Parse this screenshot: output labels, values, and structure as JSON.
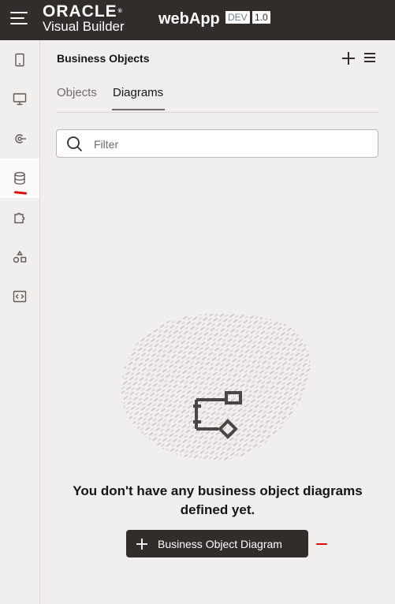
{
  "header": {
    "brand_top": "ORACLE",
    "brand_bottom": "Visual Builder",
    "app_name": "webApp",
    "badge_env": "DEV",
    "badge_version": "1.0"
  },
  "rail": {
    "items": [
      {
        "icon": "mobile-icon"
      },
      {
        "icon": "desktop-icon"
      },
      {
        "icon": "service-connection-icon"
      },
      {
        "icon": "database-icon",
        "active": true
      },
      {
        "icon": "puzzle-icon"
      },
      {
        "icon": "shapes-icon"
      },
      {
        "icon": "code-icon"
      }
    ]
  },
  "panel": {
    "title": "Business Objects",
    "tabs": [
      {
        "label": "Objects",
        "selected": false
      },
      {
        "label": "Diagrams",
        "selected": true
      }
    ],
    "search": {
      "placeholder": "Filter",
      "value": ""
    },
    "empty_message": "You don't have any business object diagrams defined yet.",
    "create_button_label": "Business Object Diagram"
  },
  "colors": {
    "header_bg": "#312d2a",
    "panel_bg": "#f1efed",
    "annotation_red": "#e00000"
  }
}
